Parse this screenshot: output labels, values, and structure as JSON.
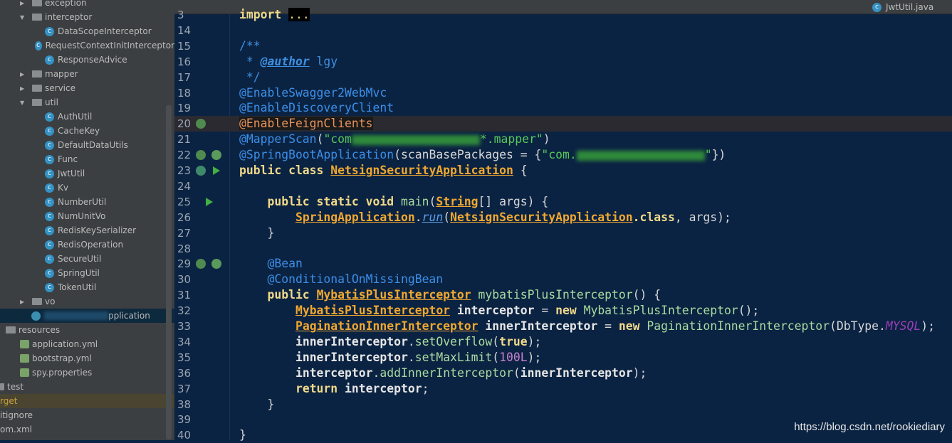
{
  "sidebar": {
    "items": [
      {
        "label": "exception",
        "type": "folder",
        "depth": 2,
        "arrow": "right"
      },
      {
        "label": "interceptor",
        "type": "folder",
        "depth": 2,
        "arrow": "down"
      },
      {
        "label": "DataScopeInterceptor",
        "type": "class",
        "depth": 3
      },
      {
        "label": "RequestContextInitInterceptor",
        "type": "class",
        "depth": 3
      },
      {
        "label": "ResponseAdvice",
        "type": "class",
        "depth": 3
      },
      {
        "label": "mapper",
        "type": "folder",
        "depth": 2,
        "arrow": "right"
      },
      {
        "label": "service",
        "type": "folder",
        "depth": 2,
        "arrow": "right"
      },
      {
        "label": "util",
        "type": "folder",
        "depth": 2,
        "arrow": "down"
      },
      {
        "label": "AuthUtil",
        "type": "class",
        "depth": 3
      },
      {
        "label": "CacheKey",
        "type": "class",
        "depth": 3
      },
      {
        "label": "DefaultDataUtils",
        "type": "class",
        "depth": 3
      },
      {
        "label": "Func",
        "type": "class",
        "depth": 3
      },
      {
        "label": "JwtUtil",
        "type": "class",
        "depth": 3
      },
      {
        "label": "Kv",
        "type": "class",
        "depth": 3
      },
      {
        "label": "NumberUtil",
        "type": "class",
        "depth": 3
      },
      {
        "label": "NumUnitVo",
        "type": "class",
        "depth": 3
      },
      {
        "label": "RedisKeySerializer",
        "type": "class",
        "depth": 3
      },
      {
        "label": "RedisOperation",
        "type": "class",
        "depth": 3
      },
      {
        "label": "SecureUtil",
        "type": "class",
        "depth": 3
      },
      {
        "label": "SpringUtil",
        "type": "class",
        "depth": 3
      },
      {
        "label": "TokenUtil",
        "type": "class",
        "depth": 3
      },
      {
        "label": "vo",
        "type": "folder",
        "depth": 2,
        "arrow": "right"
      },
      {
        "label": "pplication",
        "type": "app",
        "depth": 2,
        "selected": true
      },
      {
        "label": "resources",
        "type": "resfolder",
        "depth": 0
      },
      {
        "label": "application.yml",
        "type": "res",
        "depth": 1
      },
      {
        "label": "bootstrap.yml",
        "type": "res",
        "depth": 1
      },
      {
        "label": "spy.properties",
        "type": "res",
        "depth": 1
      },
      {
        "label": "test",
        "type": "plainfolder",
        "depth": -1
      },
      {
        "label": "rget",
        "type": "target",
        "depth": -2
      },
      {
        "label": "itignore",
        "type": "text",
        "depth": -2
      },
      {
        "label": "om.xml",
        "type": "text",
        "depth": -2
      }
    ]
  },
  "tab": {
    "label": "JwtUtil.java",
    "icon": "class-icon"
  },
  "editor": {
    "highlight_line": 20,
    "lines": [
      {
        "n": "3",
        "t": [
          [
            "import ",
            "kw"
          ],
          [
            "...",
            "fold"
          ]
        ]
      },
      {
        "n": "14",
        "t": []
      },
      {
        "n": "15",
        "t": [
          [
            "/**",
            "com"
          ]
        ]
      },
      {
        "n": "16",
        "t": [
          [
            " * ",
            "com"
          ],
          [
            "@author",
            "comtag"
          ],
          [
            " lgy",
            "com"
          ]
        ]
      },
      {
        "n": "17",
        "t": [
          [
            " */",
            "com"
          ]
        ]
      },
      {
        "n": "18",
        "t": [
          [
            "@EnableSwagger2WebMvc",
            "ann"
          ]
        ]
      },
      {
        "n": "19",
        "t": [
          [
            "@EnableDiscoveryClient",
            "ann"
          ]
        ]
      },
      {
        "n": "20",
        "t": [
          [
            "@EnableFeignClients",
            "annhl"
          ]
        ],
        "g": [
          "search"
        ]
      },
      {
        "n": "21",
        "t": [
          [
            "@MapperScan",
            "ann"
          ],
          [
            "(",
            "plain"
          ],
          [
            "\"com",
            "str"
          ],
          [
            "",
            "blur"
          ],
          [
            "*.mapper\"",
            "str"
          ],
          [
            ")",
            "plain"
          ]
        ]
      },
      {
        "n": "22",
        "t": [
          [
            "@SpringBootApplication",
            "ann"
          ],
          [
            "(scanBasePackages = {",
            "plain"
          ],
          [
            "\"com.",
            "str"
          ],
          [
            "",
            "blur"
          ],
          [
            "\"",
            "str"
          ],
          [
            "})",
            "plain"
          ]
        ],
        "g": [
          "search",
          "bean"
        ]
      },
      {
        "n": "23",
        "t": [
          [
            "public class ",
            "kw"
          ],
          [
            "NetsignSecurityApplication",
            "cls"
          ],
          [
            " {",
            "plain"
          ]
        ],
        "g": [
          "boot",
          "run"
        ]
      },
      {
        "n": "24",
        "t": []
      },
      {
        "n": "25",
        "t": [
          [
            "    public static void ",
            "kw"
          ],
          [
            "main",
            "method"
          ],
          [
            "(",
            "plain"
          ],
          [
            "String",
            "cls"
          ],
          [
            "[] args) {",
            "plain"
          ]
        ],
        "g": [
          "run"
        ]
      },
      {
        "n": "26",
        "t": [
          [
            "        ",
            "plain"
          ],
          [
            "SpringApplication",
            "cls"
          ],
          [
            ".",
            "plain"
          ],
          [
            "run",
            "stat"
          ],
          [
            "(",
            "plain"
          ],
          [
            "NetsignSecurityApplication",
            "cls"
          ],
          [
            ".class",
            "kw"
          ],
          [
            ", args);",
            "plain"
          ]
        ]
      },
      {
        "n": "27",
        "t": [
          [
            "    }",
            "plain"
          ]
        ]
      },
      {
        "n": "28",
        "t": []
      },
      {
        "n": "29",
        "t": [
          [
            "    @Bean",
            "ann"
          ]
        ],
        "g": [
          "search",
          "bean"
        ]
      },
      {
        "n": "30",
        "t": [
          [
            "    @ConditionalOnMissingBean",
            "ann"
          ]
        ]
      },
      {
        "n": "31",
        "t": [
          [
            "    public ",
            "kw"
          ],
          [
            "MybatisPlusInterceptor",
            "cls"
          ],
          [
            " mybatisPlusInterceptor",
            "method"
          ],
          [
            "() {",
            "plain"
          ]
        ]
      },
      {
        "n": "32",
        "t": [
          [
            "        ",
            "plain"
          ],
          [
            "MybatisPlusInterceptor",
            "cls"
          ],
          [
            " interceptor",
            "var"
          ],
          [
            " = ",
            "plain"
          ],
          [
            "new ",
            "kw"
          ],
          [
            "MybatisPlusInterceptor",
            "method"
          ],
          [
            "();",
            "plain"
          ]
        ]
      },
      {
        "n": "33",
        "t": [
          [
            "        ",
            "plain"
          ],
          [
            "PaginationInnerInterceptor",
            "cls"
          ],
          [
            " innerInterceptor",
            "var"
          ],
          [
            " = ",
            "plain"
          ],
          [
            "new ",
            "kw"
          ],
          [
            "PaginationInnerInterceptor",
            "method"
          ],
          [
            "(DbType.",
            "plain"
          ],
          [
            "MYSQL",
            "const"
          ],
          [
            ");",
            "plain"
          ]
        ]
      },
      {
        "n": "34",
        "t": [
          [
            "        ",
            "plain"
          ],
          [
            "innerInterceptor",
            "var"
          ],
          [
            ".",
            "plain"
          ],
          [
            "setOverflow",
            "method"
          ],
          [
            "(",
            "plain"
          ],
          [
            "true",
            "kw"
          ],
          [
            ");",
            "plain"
          ]
        ]
      },
      {
        "n": "35",
        "t": [
          [
            "        ",
            "plain"
          ],
          [
            "innerInterceptor",
            "var"
          ],
          [
            ".",
            "plain"
          ],
          [
            "setMaxLimit",
            "method"
          ],
          [
            "(",
            "plain"
          ],
          [
            "100L",
            "num"
          ],
          [
            ");",
            "plain"
          ]
        ]
      },
      {
        "n": "36",
        "t": [
          [
            "        ",
            "plain"
          ],
          [
            "interceptor",
            "var"
          ],
          [
            ".",
            "plain"
          ],
          [
            "addInnerInterceptor",
            "method"
          ],
          [
            "(",
            "plain"
          ],
          [
            "innerInterceptor",
            "var"
          ],
          [
            ");",
            "plain"
          ]
        ]
      },
      {
        "n": "37",
        "t": [
          [
            "        ",
            "plain"
          ],
          [
            "return ",
            "kw"
          ],
          [
            "interceptor",
            "var"
          ],
          [
            ";",
            "plain"
          ]
        ]
      },
      {
        "n": "38",
        "t": [
          [
            "    }",
            "plain"
          ]
        ]
      },
      {
        "n": "39",
        "t": []
      },
      {
        "n": "40",
        "t": [
          [
            "}",
            "plain"
          ]
        ]
      }
    ]
  },
  "watermark": "https://blog.csdn.net/rookiediary"
}
